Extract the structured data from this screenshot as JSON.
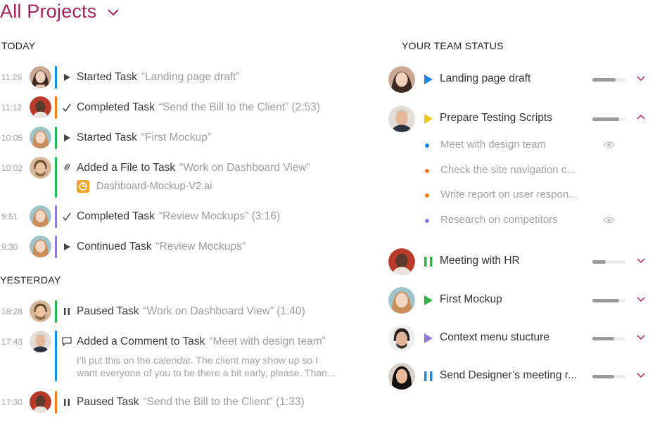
{
  "header": {
    "title": "All Projects"
  },
  "sections": {
    "today": "TODAY",
    "yesterday": "YESTERDAY",
    "team": "YOUR TEAM STATUS"
  },
  "colors": {
    "accent": "#a0245a",
    "blue": "#1e88e5",
    "orange": "#f57c1f",
    "green": "#2fb34a",
    "purple": "#8f7be0",
    "yellow": "#f7c21a"
  },
  "today": [
    {
      "time": "11:26",
      "verb": "Started Task",
      "object": "“Landing page draft”",
      "icon": "play-icon"
    },
    {
      "time": "11:12",
      "verb": "Completed Task",
      "object": "“Send the Bill to the Client” (2:53)",
      "icon": "check-icon"
    },
    {
      "time": "10:05",
      "verb": "Started Task",
      "object": "“First Mockup”",
      "icon": "play-icon"
    },
    {
      "time": "10:02",
      "verb": "Added a File to Task",
      "object": "“Work on Dashboard View”",
      "icon": "paperclip-icon",
      "file": "Dashboard-Mockup-V2.ai"
    },
    {
      "time": "9:51",
      "verb": "Completed Task",
      "object": "“Review Mockups” (3:16)",
      "icon": "check-icon"
    },
    {
      "time": "9:30",
      "verb": "Continued Task",
      "object": "“Review Mockups”",
      "icon": "play-icon"
    }
  ],
  "yesterday": [
    {
      "time": "18:28",
      "verb": "Paused Task",
      "object": "“Work on Dashboard View” (1:40)",
      "icon": "pause-icon"
    },
    {
      "time": "17:43",
      "verb": "Added a Comment to Task",
      "object": "“Meet with design team”",
      "icon": "comment-icon",
      "comment_line1": "I’ll put this on the calendar. The client may show up so I",
      "comment_line2": "want everyone of you to be there a bit early, please. Than..."
    },
    {
      "time": "17:30",
      "verb": "Paused Task",
      "object": "“Send the Bill to the Client” (1:33)",
      "icon": "pause-icon"
    }
  ],
  "team": [
    {
      "task": "Landing page draft",
      "state": "playing",
      "progress": 0.7
    },
    {
      "task": "Prepare Testing Scripts",
      "state": "playing",
      "progress": 0.8,
      "expanded": true,
      "subtasks": [
        {
          "label": "Meet with design team",
          "watch": true
        },
        {
          "label": "Check the site navigation c...",
          "watch": false
        },
        {
          "label": "Write report on user respon...",
          "watch": false
        },
        {
          "label": "Research on competitors",
          "watch": true
        }
      ]
    },
    {
      "task": "Meeting with HR",
      "state": "paused",
      "progress": 0.4
    },
    {
      "task": "First Mockup",
      "state": "playing",
      "progress": 0.8
    },
    {
      "task": "Context menu stucture",
      "state": "playing",
      "progress": 0.65
    },
    {
      "task": "Send Designer’s meeting r...",
      "state": "paused",
      "progress": 0.65
    }
  ]
}
